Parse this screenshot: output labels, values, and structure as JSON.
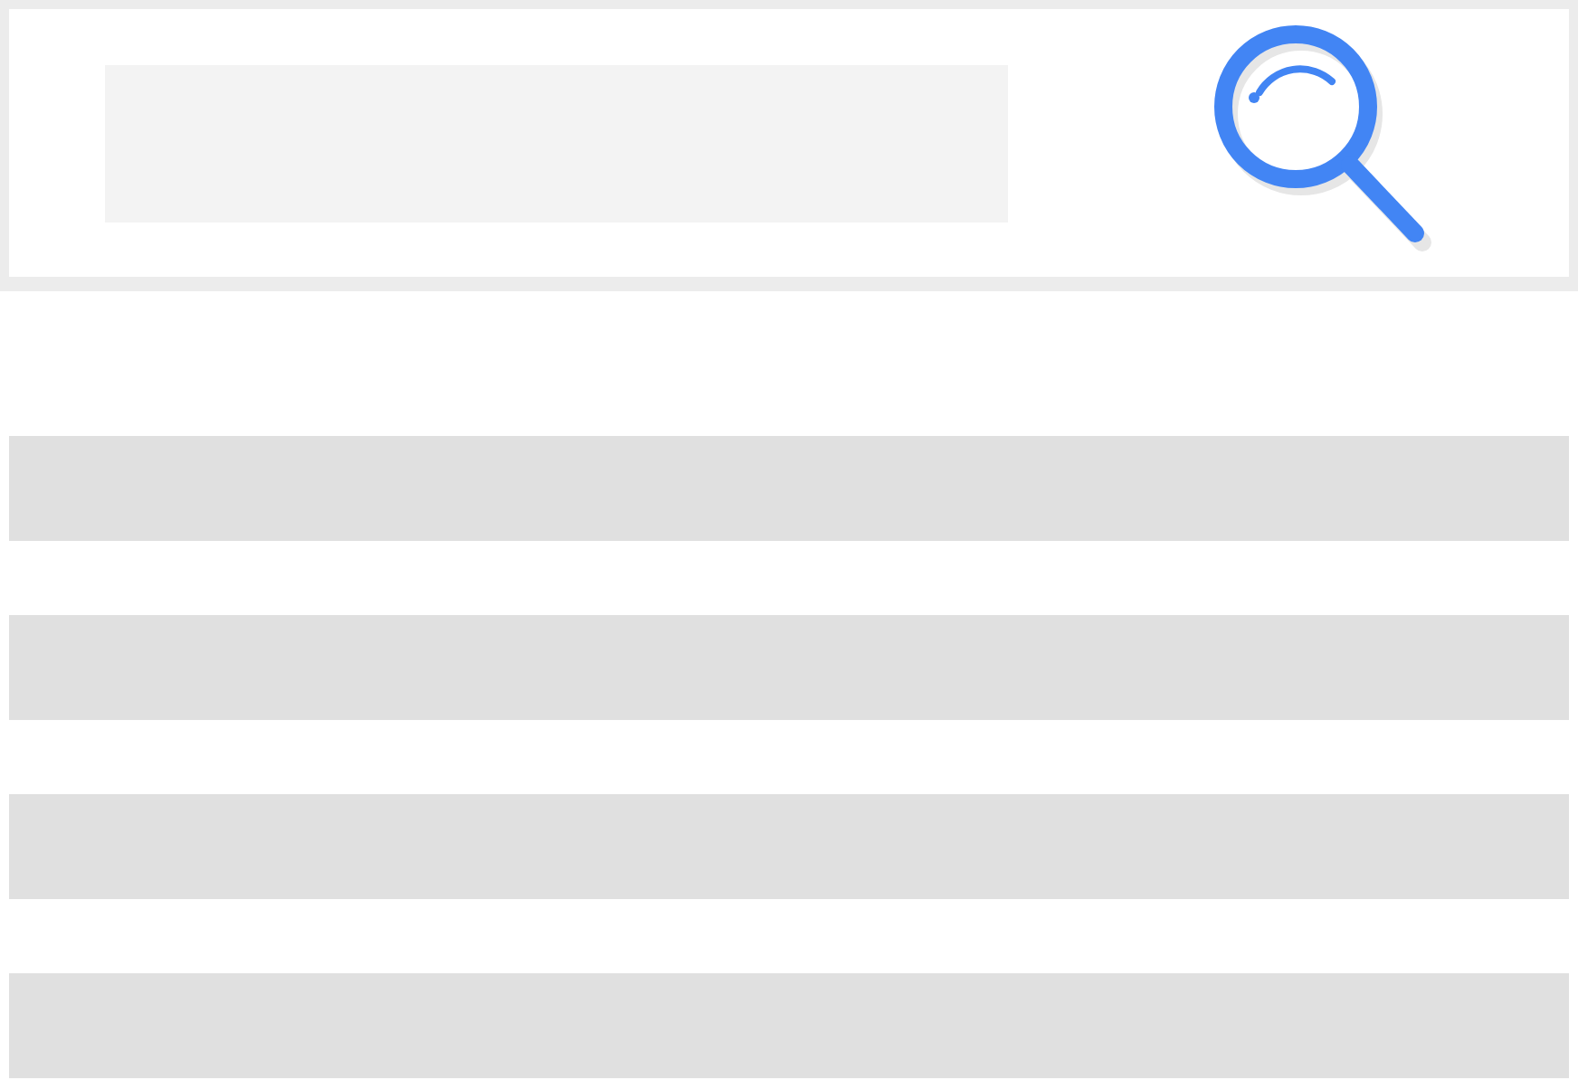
{
  "search": {
    "kind": "field"
  },
  "results": [
    {
      "kind": "placeholder"
    },
    {
      "kind": "placeholder"
    },
    {
      "kind": "placeholder"
    },
    {
      "kind": "placeholder"
    }
  ]
}
